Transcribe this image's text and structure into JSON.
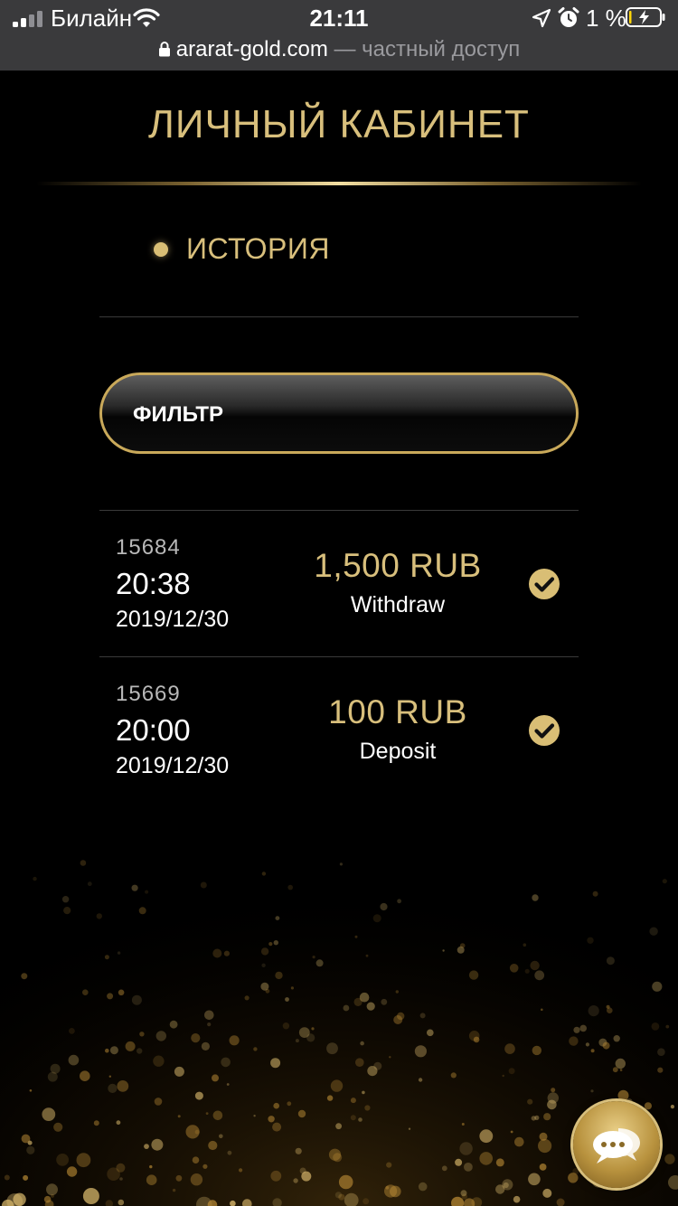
{
  "status_bar": {
    "carrier": "Билайн",
    "time": "21:11",
    "battery_percent": "1 %"
  },
  "browser": {
    "host": "ararat-gold.com",
    "suffix": " — частный доступ"
  },
  "page": {
    "title": "ЛИЧНЫЙ КАБИНЕТ",
    "section_label": "ИСТОРИЯ",
    "filter_label": "ФИЛЬТР"
  },
  "transactions": [
    {
      "id": "15684",
      "time": "20:38",
      "date": "2019/12/30",
      "amount": "1,500 RUB",
      "type": "Withdraw",
      "status_icon": "check-circle-icon"
    },
    {
      "id": "15669",
      "time": "20:00",
      "date": "2019/12/30",
      "amount": "100 RUB",
      "type": "Deposit",
      "status_icon": "check-circle-icon"
    }
  ],
  "colors": {
    "gold": "#d8bf7c",
    "background": "#000000",
    "status_bar": "#3a3a3c"
  },
  "chat": {
    "icon": "chat-bubbles-icon"
  }
}
